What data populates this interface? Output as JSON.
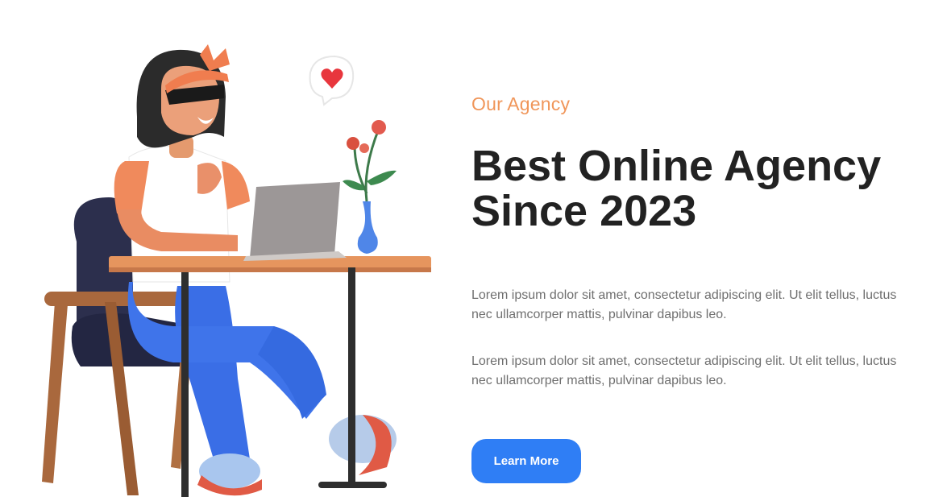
{
  "hero": {
    "eyebrow": "Our Agency",
    "headline_line1": "Best Online Agency",
    "headline_line2": "Since 2023",
    "paragraphs": [
      "Lorem ipsum dolor sit amet, consectetur adipiscing elit. Ut elit tellus, luctus nec ullamcorper mattis, pulvinar dapibus leo.",
      "Lorem ipsum dolor sit amet, consectetur adipiscing elit. Ut elit tellus, luctus nec ullamcorper mattis, pulvinar dapibus leo."
    ],
    "cta_label": "Learn More"
  },
  "colors": {
    "accent": "#f0965a",
    "button": "#2f7ef5",
    "heading": "#222222",
    "body_text": "#6f6f6f"
  },
  "illustration": {
    "icons": [
      "heart-icon",
      "laptop-icon",
      "flower-vase-icon",
      "chair-icon",
      "desk-icon"
    ]
  }
}
